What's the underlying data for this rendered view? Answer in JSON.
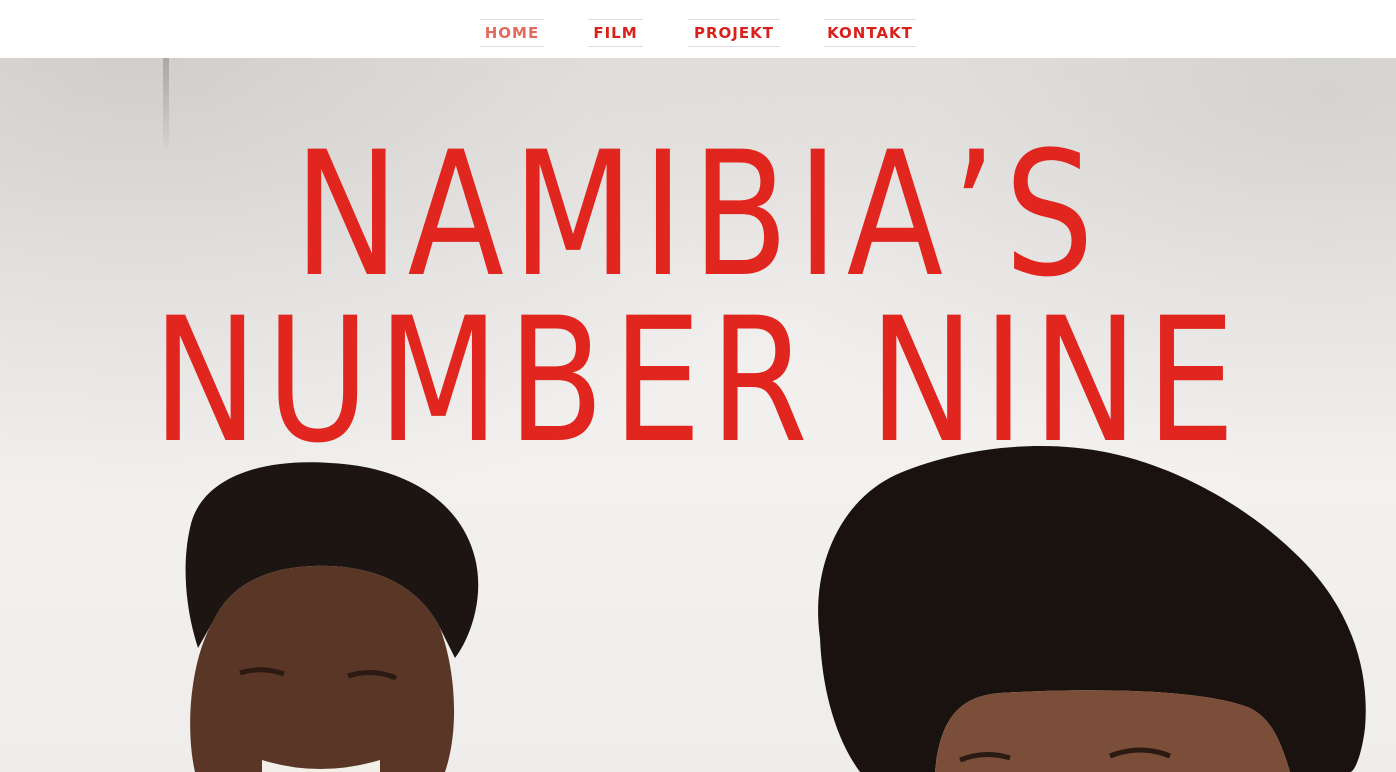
{
  "nav": {
    "items": [
      {
        "label": "HOME",
        "active": true
      },
      {
        "label": "FILM",
        "active": false
      },
      {
        "label": "PROJEKT",
        "active": false
      },
      {
        "label": "KONTAKT",
        "active": false
      }
    ]
  },
  "hero": {
    "title_line1": "NAMIBIA’S",
    "title_line2": "NUMBER NINE"
  },
  "colors": {
    "accent": "#e0261f",
    "nav_active": "#e36a5e",
    "background": "#ffffff"
  }
}
